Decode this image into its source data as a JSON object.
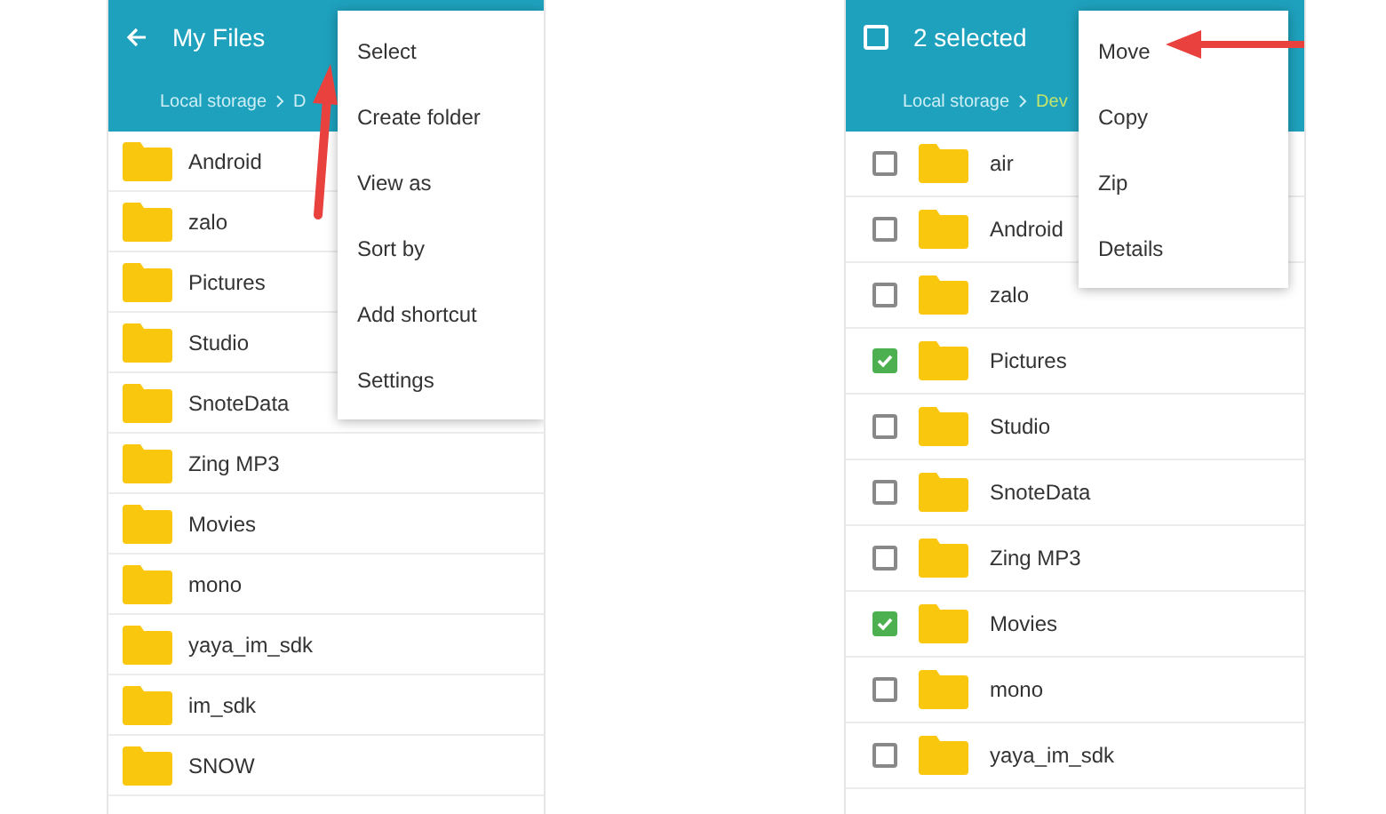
{
  "screens": [
    {
      "kind": "browse",
      "header": {
        "title": "My Files"
      },
      "breadcrumb": [
        {
          "label": "Local storage",
          "current": false
        },
        {
          "label": "D",
          "current": false
        }
      ],
      "rows": [
        {
          "name": "Android"
        },
        {
          "name": "zalo"
        },
        {
          "name": "Pictures"
        },
        {
          "name": "Studio"
        },
        {
          "name": "SnoteData"
        },
        {
          "name": "Zing MP3"
        },
        {
          "name": "Movies"
        },
        {
          "name": "mono"
        },
        {
          "name": "yaya_im_sdk"
        },
        {
          "name": "im_sdk"
        },
        {
          "name": "SNOW"
        }
      ],
      "menu": [
        "Select",
        "Create folder",
        "View as",
        "Sort by",
        "Add shortcut",
        "Settings"
      ]
    },
    {
      "kind": "select",
      "header": {
        "title": "2 selected",
        "checked": false
      },
      "breadcrumb": [
        {
          "label": "Local storage",
          "current": false
        },
        {
          "label": "Dev",
          "current": true
        }
      ],
      "rows": [
        {
          "name": "air",
          "checked": false
        },
        {
          "name": "Android",
          "checked": false
        },
        {
          "name": "zalo",
          "checked": false
        },
        {
          "name": "Pictures",
          "checked": true
        },
        {
          "name": "Studio",
          "checked": false
        },
        {
          "name": "SnoteData",
          "checked": false
        },
        {
          "name": "Zing MP3",
          "checked": false
        },
        {
          "name": "Movies",
          "checked": true
        },
        {
          "name": "mono",
          "checked": false
        },
        {
          "name": "yaya_im_sdk",
          "checked": false
        }
      ],
      "menu": [
        "Move",
        "Copy",
        "Zip",
        "Details"
      ]
    }
  ]
}
